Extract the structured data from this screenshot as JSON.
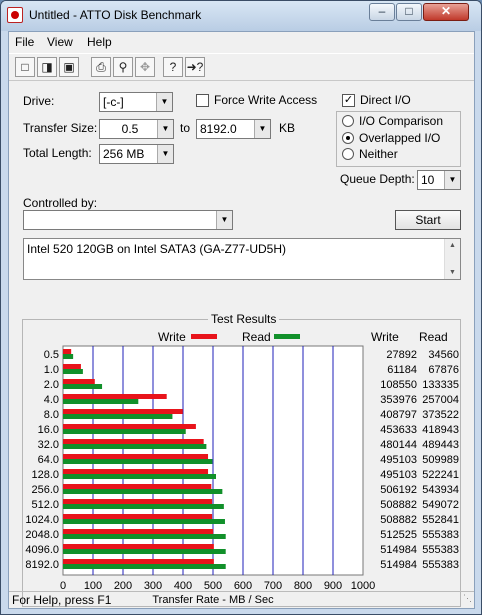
{
  "window": {
    "title": "Untitled - ATTO Disk Benchmark"
  },
  "menu": [
    "File",
    "View",
    "Help"
  ],
  "toolbar": [
    "new-icon",
    "open-icon",
    "save-icon",
    "print-icon",
    "print-preview-icon",
    "move-icon",
    "help-icon",
    "context-help-icon"
  ],
  "form": {
    "drive_label": "Drive:",
    "drive_value": "[-c-]",
    "force_write_label": "Force Write Access",
    "direct_io_label": "Direct I/O",
    "direct_io_checked": true,
    "transfer_size_label": "Transfer Size:",
    "transfer_from": "0.5",
    "to_label": "to",
    "transfer_to": "8192.0",
    "kb_label": "KB",
    "total_length_label": "Total Length:",
    "total_length_value": "256 MB",
    "io_comparison_label": "I/O Comparison",
    "overlapped_io_label": "Overlapped I/O",
    "neither_label": "Neither",
    "selected_mode": "Overlapped I/O",
    "queue_depth_label": "Queue Depth:",
    "queue_depth_value": "10",
    "controlled_by_label": "Controlled by:",
    "controlled_by_value": "",
    "start_label": "Start",
    "description": "Intel 520 120GB on Intel SATA3 (GA-Z77-UD5H)"
  },
  "results": {
    "title": "Test Results",
    "write_legend": "Write",
    "read_legend": "Read",
    "write_col": "Write",
    "read_col": "Read",
    "colors": {
      "write": "#e8141b",
      "read": "#11902a",
      "grid": "#1f1fb8"
    }
  },
  "chart_data": {
    "type": "bar",
    "orientation": "horizontal",
    "categories": [
      "0.5",
      "1.0",
      "2.0",
      "4.0",
      "8.0",
      "16.0",
      "32.0",
      "64.0",
      "128.0",
      "256.0",
      "512.0",
      "1024.0",
      "2048.0",
      "4096.0",
      "8192.0"
    ],
    "series": [
      {
        "name": "Write",
        "values": [
          27892,
          61184,
          108550,
          353976,
          408797,
          453633,
          480144,
          495103,
          495103,
          506192,
          508882,
          508882,
          512525,
          514984,
          514984
        ]
      },
      {
        "name": "Read",
        "values": [
          34560,
          67876,
          133335,
          257004,
          373522,
          418943,
          489443,
          509989,
          522241,
          543934,
          549072,
          552841,
          555383,
          555383,
          555383
        ]
      }
    ],
    "xlabel": "Transfer Rate - MB / Sec",
    "xticks": [
      "0",
      "100",
      "200",
      "300",
      "400",
      "500",
      "600",
      "700",
      "800",
      "900",
      "1000"
    ],
    "xlim": [
      0,
      1000
    ],
    "grid": true
  },
  "status": {
    "text": "For Help, press F1"
  }
}
